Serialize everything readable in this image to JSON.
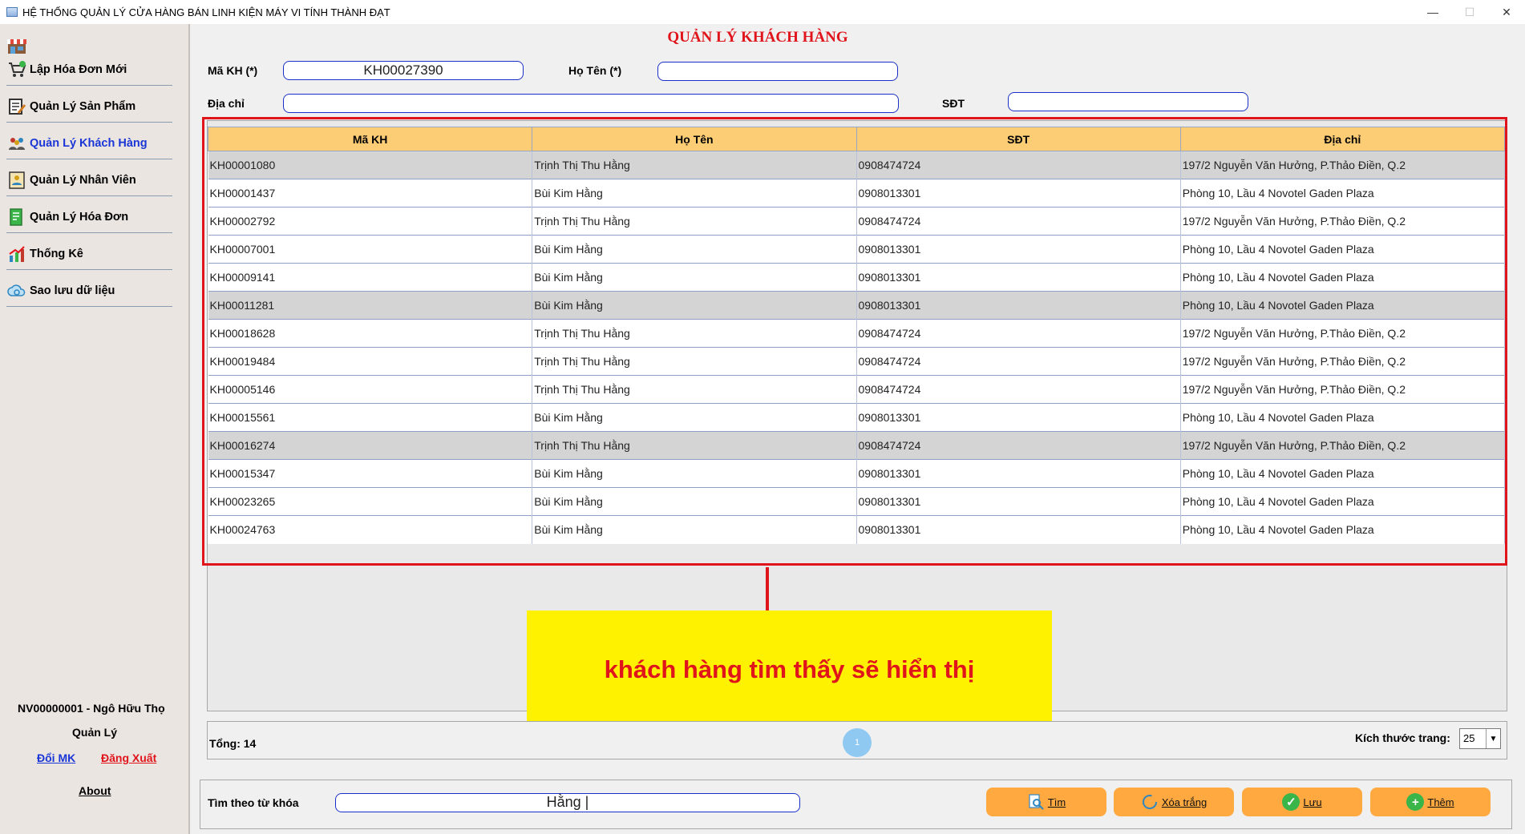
{
  "window": {
    "title": "HỆ THỐNG QUẢN LÝ CỬA HÀNG BÁN LINH KIỆN MÁY VI TÍNH THÀNH ĐẠT",
    "minimize": "—",
    "maximize": "☐",
    "close": "✕"
  },
  "sidebar": {
    "items": [
      {
        "label": "Lập Hóa Đơn Mới",
        "icon": "cart-icon"
      },
      {
        "label": "Quản Lý Sản Phẩm",
        "icon": "edit-icon"
      },
      {
        "label": "Quản Lý Khách Hàng",
        "icon": "customers-icon"
      },
      {
        "label": "Quản Lý Nhân Viên",
        "icon": "employee-icon"
      },
      {
        "label": "Quản Lý Hóa Đơn",
        "icon": "invoice-icon"
      },
      {
        "label": "Thống Kê",
        "icon": "chart-icon"
      },
      {
        "label": "Sao lưu dữ liệu",
        "icon": "backup-icon"
      }
    ],
    "active_index": 2,
    "user_line1": "NV00000001 - Ngô Hữu  Thọ",
    "user_role": "Quản Lý",
    "change_password": "Đổi MK",
    "logout": "Đăng Xuất",
    "about": "About"
  },
  "form": {
    "heading": "QUẢN LÝ KHÁCH HÀNG",
    "ma_kh_label": "Mã KH (*)",
    "ma_kh_value": "KH00027390",
    "ho_ten_label": "Họ Tên (*)",
    "ho_ten_value": "",
    "dia_chi_label": "Địa chỉ",
    "dia_chi_value": "",
    "sdt_label": "SĐT",
    "sdt_value": ""
  },
  "table": {
    "columns": [
      "Mã KH",
      "Họ Tên",
      "SĐT",
      "Địa chỉ"
    ],
    "rows": [
      [
        "KH00001080",
        "Trịnh Thị Thu Hằng",
        "0908474724",
        "197/2 Nguyễn Văn Hưởng, P.Thảo Điền, Q.2"
      ],
      [
        "KH00001437",
        "Bùi Kim Hằng",
        "0908013301",
        "Phòng 10, Lầu 4 Novotel Gaden Plaza"
      ],
      [
        "KH00002792",
        "Trịnh Thị Thu Hằng",
        "0908474724",
        "197/2 Nguyễn Văn Hưởng, P.Thảo Điền, Q.2"
      ],
      [
        "KH00007001",
        "Bùi Kim Hằng",
        "0908013301",
        "Phòng 10, Lầu 4 Novotel Gaden Plaza"
      ],
      [
        "KH00009141",
        "Bùi Kim Hằng",
        "0908013301",
        "Phòng 10, Lầu 4 Novotel Gaden Plaza"
      ],
      [
        "KH00011281",
        "Bùi Kim Hằng",
        "0908013301",
        "Phòng 10, Lầu 4 Novotel Gaden Plaza"
      ],
      [
        "KH00018628",
        "Trịnh Thị Thu Hằng",
        "0908474724",
        "197/2 Nguyễn Văn Hưởng, P.Thảo Điền, Q.2"
      ],
      [
        "KH00019484",
        "Trịnh Thị Thu Hằng",
        "0908474724",
        "197/2 Nguyễn Văn Hưởng, P.Thảo Điền, Q.2"
      ],
      [
        "KH00005146",
        "Trịnh Thị Thu Hằng",
        "0908474724",
        "197/2 Nguyễn Văn Hưởng, P.Thảo Điền, Q.2"
      ],
      [
        "KH00015561",
        "Bùi Kim Hằng",
        "0908013301",
        "Phòng 10, Lầu 4 Novotel Gaden Plaza"
      ],
      [
        "KH00016274",
        "Trịnh Thị Thu Hằng",
        "0908474724",
        "197/2 Nguyễn Văn Hưởng, P.Thảo Điền, Q.2"
      ],
      [
        "KH00015347",
        "Bùi Kim Hằng",
        "0908013301",
        "Phòng 10, Lầu 4 Novotel Gaden Plaza"
      ],
      [
        "KH00023265",
        "Bùi Kim Hằng",
        "0908013301",
        "Phòng 10, Lầu 4 Novotel Gaden Plaza"
      ],
      [
        "KH00024763",
        "Bùi Kim Hằng",
        "0908013301",
        "Phòng 10, Lầu 4 Novotel Gaden Plaza"
      ]
    ],
    "shaded_rows": [
      0,
      5,
      10
    ]
  },
  "annotation": {
    "text": "khách hàng tìm thấy sẽ hiển thị",
    "color": "#e0141b",
    "background": "#fff200"
  },
  "pagination": {
    "total_label": "Tổng: 14",
    "current_page": "1",
    "page_size_label": "Kích thước trang:",
    "page_size_value": "25"
  },
  "search": {
    "label": "Tìm theo từ khóa",
    "value": "Hằng |"
  },
  "buttons": [
    {
      "label": "Tìm",
      "icon": "search-icon"
    },
    {
      "label": "Xóa trắng",
      "icon": "refresh-icon"
    },
    {
      "label": "Lưu",
      "icon": "check-icon"
    },
    {
      "label": "Thêm",
      "icon": "plus-icon"
    }
  ],
  "colors": {
    "accent": "#1a36d6",
    "heading": "#e0141b",
    "button": "#ffa940",
    "table_header": "#fdcd75"
  }
}
